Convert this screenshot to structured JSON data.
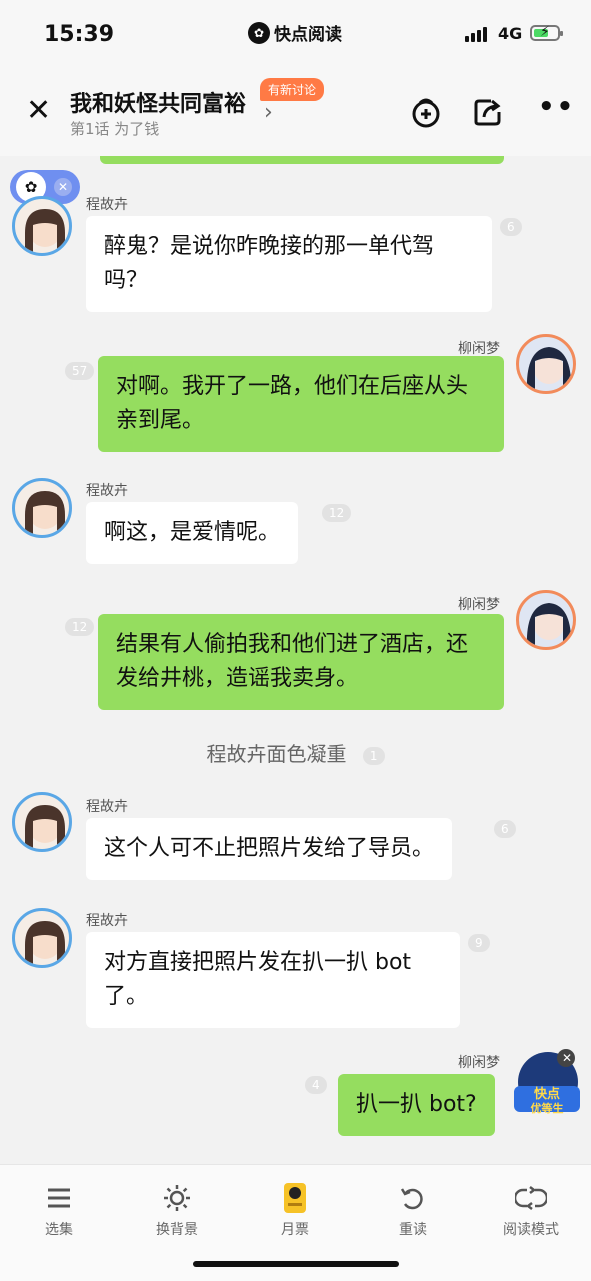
{
  "status_bar": {
    "time": "15:39",
    "app_name": "快点阅读",
    "network": "4G"
  },
  "header": {
    "title": "我和妖怪共同富裕",
    "subtitle": "第1话 为了钱",
    "badge": "有新讨论",
    "icons": [
      "close-icon",
      "add-bag-icon",
      "share-icon",
      "more-icon"
    ]
  },
  "messages": [
    {
      "side": "left",
      "name": "程故卉",
      "text": "醉鬼？是说你昨晚接的那一单代驾吗？",
      "count": "6"
    },
    {
      "side": "right",
      "name": "柳闲梦",
      "text": "对啊。我开了一路，他们在后座从头亲到尾。",
      "count": "57"
    },
    {
      "side": "left",
      "name": "程故卉",
      "text": "啊这，是爱情呢。",
      "count": "12"
    },
    {
      "side": "right",
      "name": "柳闲梦",
      "text": "结果有人偷拍我和他们进了酒店，还发给井桃，造谣我卖身。",
      "count": "12"
    },
    {
      "side": "left",
      "name": "程故卉",
      "text": "这个人可不止把照片发给了导员。",
      "count": "6"
    },
    {
      "side": "left",
      "name": "程故卉",
      "text": "对方直接把照片发在扒一扒 bot了。",
      "count": "9"
    },
    {
      "side": "right",
      "name": "柳闲梦",
      "text": "扒一扒 bot?",
      "count": "4"
    }
  ],
  "narration": {
    "text": "程故卉面色凝重",
    "count": "1"
  },
  "promo": {
    "line1": "快点",
    "line2": "优等生"
  },
  "bottom_tabs": [
    {
      "label": "选集",
      "icon": "menu-icon"
    },
    {
      "label": "换背景",
      "icon": "sun-icon"
    },
    {
      "label": "月票",
      "icon": "ticket-icon"
    },
    {
      "label": "重读",
      "icon": "replay-icon"
    },
    {
      "label": "阅读模式",
      "icon": "loop-icon"
    }
  ],
  "colors": {
    "right_bubble": "#95dd5f",
    "left_bubble": "#ffffff",
    "badge": "#ff7a45"
  }
}
